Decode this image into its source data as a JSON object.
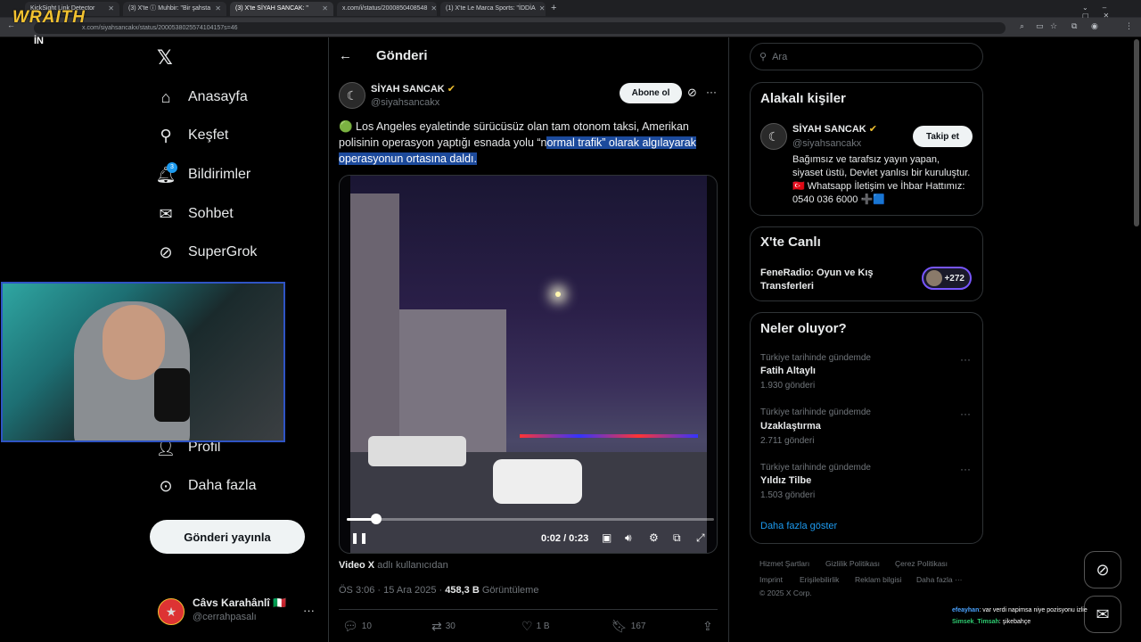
{
  "browser": {
    "tabs": [
      {
        "label": "KickSight Link Detector"
      },
      {
        "label": "(3) X'te ⓘ Muhbir: \"Bir şahsta"
      },
      {
        "label": "(3) X'te SİYAH SANCAK: \""
      },
      {
        "label": "x.com/i/status/2000850408548"
      },
      {
        "label": "(1) X'te Le Marca Sports: \"İDDİA"
      }
    ],
    "new_tab": "+",
    "url": "x.com/siyahsancakx/status/2000538025574104157s=46"
  },
  "overlay": {
    "brand": "WRAITH",
    "brand_sub": "İN"
  },
  "nav": {
    "items": [
      {
        "label": "Anasayfa",
        "icon": "home-icon"
      },
      {
        "label": "Keşfet",
        "icon": "search-icon"
      },
      {
        "label": "Bildirimler",
        "icon": "bell-icon",
        "badge": "3"
      },
      {
        "label": "Sohbet",
        "icon": "mail-icon"
      },
      {
        "label": "SuperGrok",
        "icon": "grok-icon"
      },
      {
        "label": "Profil",
        "icon": "person-icon"
      },
      {
        "label": "Daha fazla",
        "icon": "more-circle-icon"
      }
    ],
    "post_button": "Gönderi yayınla",
    "account": {
      "name": "Câvs Karahânlî 🇮🇹",
      "handle": "@cerrahpasalı"
    }
  },
  "post": {
    "header_title": "Gönderi",
    "author_name": "SİYAH SANCAK",
    "author_handle": "@siyahsancakx",
    "follow_label": "Abone ol",
    "text_plain": "🟢 Los Angeles eyaletinde sürücüsüz olan tam otonom taksi, Amerikan polisinin operasyon yaptığı esnada yolu “n",
    "text_highlight": "ormal trafik” olarak algılayarak operasyonun ortasına daldı.",
    "video": {
      "time": "0:02 / 0:23",
      "progress": 0.08
    },
    "via_bold": "Video X",
    "via_rest": "adlı kullanıcıdan",
    "meta_time": "ÖS 3:06 · 15 Ara 2025 · ",
    "meta_views": "458,3 B",
    "meta_views_label": "Görüntüleme",
    "actions": {
      "replies": "10",
      "reposts": "30",
      "likes": "1 B",
      "bookmarks": "167"
    }
  },
  "right": {
    "search_placeholder": "Ara",
    "related": {
      "title": "Alakalı kişiler",
      "name": "SİYAH SANCAK",
      "handle": "@siyahsancakx",
      "follow": "Takip et",
      "bio": "Bağımsız ve tarafsız yayın yapan, siyaset üstü, Devlet yanlısı bir kuruluştur. 🇹🇷 Whatsapp İletişim ve İhbar Hattımız: 0540 036 6000 ➕🟦"
    },
    "live": {
      "title": "X'te Canlı",
      "name": "FeneRadio: Oyun ve Kış Transferleri",
      "count": "+272"
    },
    "trends": {
      "title": "Neler oluyor?",
      "items": [
        {
          "context": "Türkiye tarihinde gündemde",
          "name": "Fatih Altaylı",
          "count": "1.930 gönderi"
        },
        {
          "context": "Türkiye tarihinde gündemde",
          "name": "Uzaklaştırma",
          "count": "2.711 gönderi"
        },
        {
          "context": "Türkiye tarihinde gündemde",
          "name": "Yıldız Tilbe",
          "count": "1.503 gönderi"
        }
      ],
      "show_more": "Daha fazla göster"
    },
    "footer": [
      "Hizmet Şartları",
      "Gizlilik Politikası",
      "Çerez Politikası",
      "Imprint",
      "Erişilebilirlik",
      "Reklam bilgisi",
      "Daha fazla ···",
      "© 2025 X Corp."
    ]
  },
  "chat": [
    {
      "user": "efeayhan",
      "msg": ": var verdi napimsa niye pozisyonu izlie"
    },
    {
      "user": "Simsek_Timsah",
      "msg": ": şikebahçe"
    }
  ],
  "colors": {
    "accent": "#1d9bf0",
    "highlight": "#1c4a9c",
    "webcam_border": "#2f54c4",
    "brand": "#f2c230"
  }
}
